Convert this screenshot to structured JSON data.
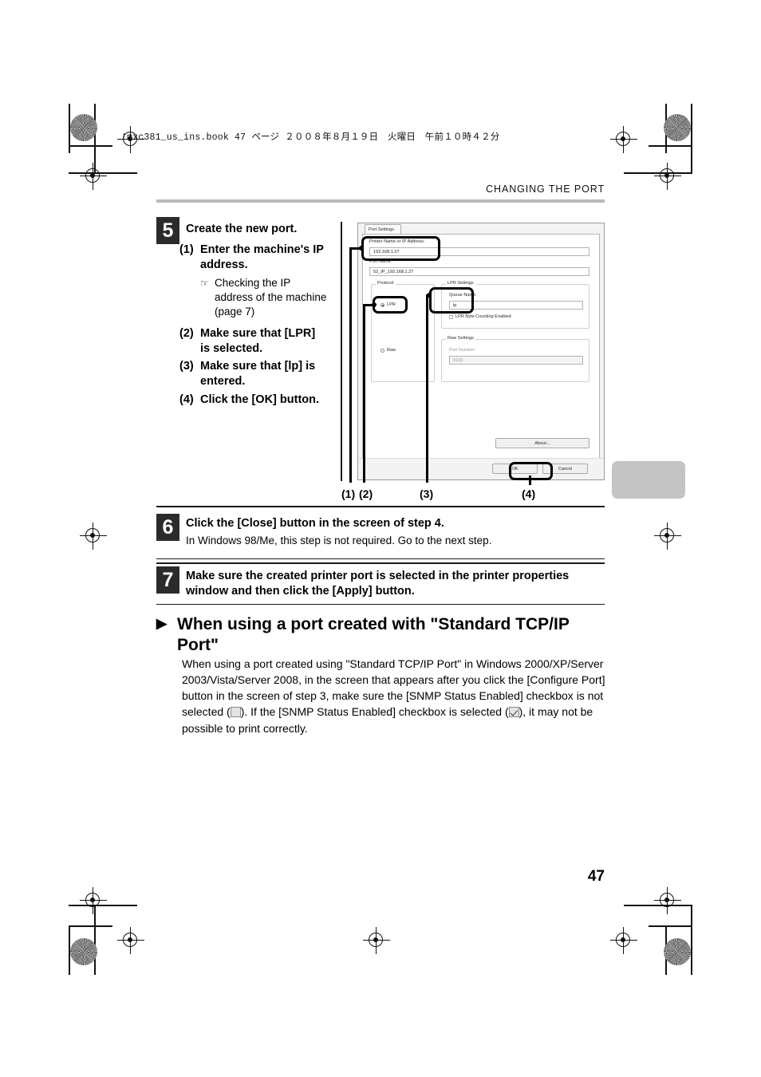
{
  "print_marks": {
    "book_info": "!mxc381_us_ins.book  47 ページ  ２００８年８月１９日　火曜日　午前１０時４２分"
  },
  "header": {
    "running_head": "CHANGING THE PORT"
  },
  "steps": [
    {
      "number": "5",
      "title": "Create the new port.",
      "items": [
        {
          "label": "(1)",
          "text": "Enter the machine's IP address.",
          "note_icon": "☞",
          "note": "Checking the IP address of the machine (page 7)"
        },
        {
          "label": "(2)",
          "text": "Make sure that [LPR] is selected."
        },
        {
          "label": "(3)",
          "text": "Make sure that [lp] is entered."
        },
        {
          "label": "(4)",
          "text": "Click the [OK] button."
        }
      ]
    },
    {
      "number": "6",
      "title": "Click the [Close] button in the screen of step 4.",
      "subtitle": "In Windows 98/Me, this step is not required. Go to the next step."
    },
    {
      "number": "7",
      "title": "Make sure the created printer port is selected in the printer properties window and then click the [Apply] button."
    }
  ],
  "dialog": {
    "tab_label": "Port Settings",
    "printer_name_label": "Printer Name or IP Address:",
    "printer_name_value": "192.168.1.27",
    "port_name_label": "Port Name:",
    "port_name_value": "52_IP_192.168.1.27",
    "protocol_group": "Protocol",
    "protocol_lpr": "LPR",
    "protocol_raw": "Raw",
    "lpr_group": "LPR Settings",
    "queue_name_label": "Queue Name:",
    "queue_name_value": "lp",
    "lpr_byte_counting": "LPR Byte Counting Enabled",
    "raw_group": "Raw Settings",
    "port_number_label": "Port Number:",
    "port_number_value": "9100",
    "about_button": "About...",
    "ok_button": "OK",
    "cancel_button": "Cancel"
  },
  "callout_labels": [
    "(1)",
    "(2)",
    "(3)",
    "(4)"
  ],
  "section": {
    "bullet": "▶",
    "heading": "When using a port created with \"Standard TCP/IP Port\"",
    "body_part1": "When using a port created using \"Standard TCP/IP Port\" in Windows 2000/XP/Server 2003/Vista/Server 2008, in the screen that appears after you click the [Configure Port] button in the screen of step 3, make sure the [SNMP Status Enabled] checkbox is not selected (",
    "body_part2": "). If the [SNMP Status Enabled] checkbox is selected (",
    "body_part3": "), it may not be possible to print correctly."
  },
  "footer": {
    "page_number": "47"
  }
}
